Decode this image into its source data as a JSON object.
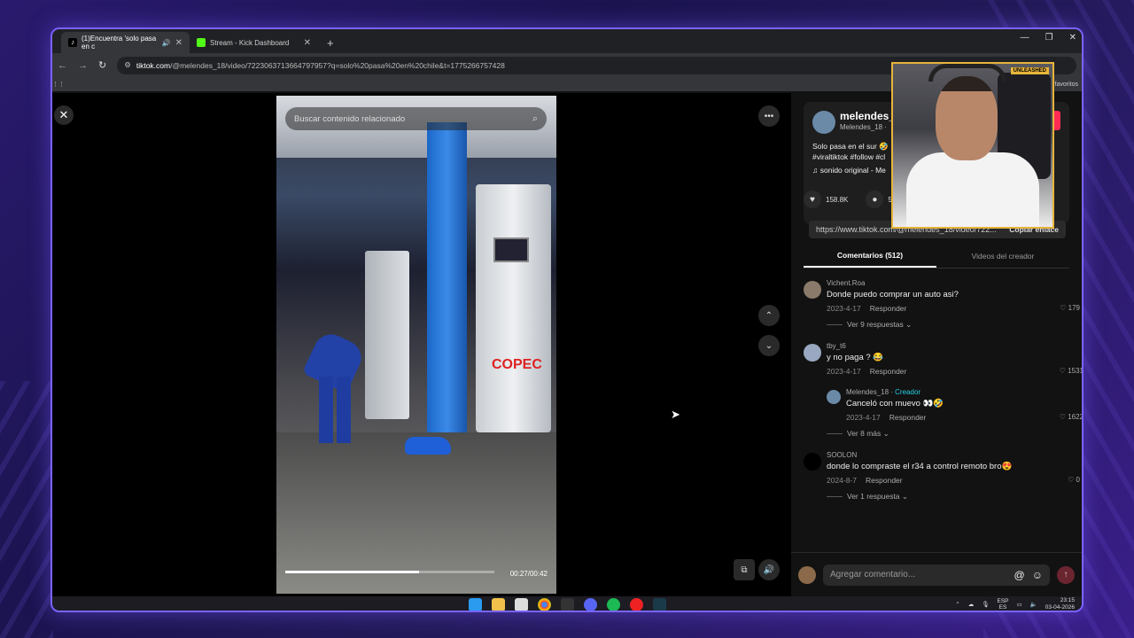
{
  "browser": {
    "tabs": [
      {
        "label": "(1)Encuentra 'solo pasa en c",
        "active": true
      },
      {
        "label": "Stream - Kick Dashboard",
        "active": false
      }
    ],
    "url_host": "tiktok.com",
    "url_path": "/@melendes_18/video/7223063713664797957?q=solo%20pasa%20en%20chile&t=1775266757428",
    "bookmarks_label": "favoritos"
  },
  "video": {
    "search_placeholder": "Buscar contenido relacionado",
    "time": "00:27/00:42",
    "progress": 0.64,
    "pump_brand": "COPEC"
  },
  "author": {
    "name": "melendes_1",
    "handle": "Melendes_18 · ",
    "description_line1": "Solo pasa en el sur 🤣",
    "description_line2": "#viraltiktok #follow #cl",
    "music": "♫  sonido original - Me"
  },
  "stats": {
    "likes": "158.8K",
    "comments": "51"
  },
  "share": {
    "url": "https://www.tiktok.com/@melendes_18/video/722...",
    "copy_label": "Copiar enlace"
  },
  "comment_tabs": [
    {
      "label": "Comentarios (512)",
      "active": true
    },
    {
      "label": "Videos del creador",
      "active": false
    }
  ],
  "comments": [
    {
      "user": "Vichent.Roa",
      "creator": "",
      "text": "Donde puedo comprar un auto asi?",
      "date": "2023-4-17",
      "reply": "Responder",
      "likes": "179",
      "more": "Ver 9 respuestas ⌄"
    },
    {
      "user": "tby_t6",
      "creator": "",
      "text": "y no paga ? 😂",
      "date": "2023-4-17",
      "reply": "Responder",
      "likes": "1531",
      "more": ""
    },
    {
      "user": "Melendes_18 · ",
      "creator": "Creador",
      "text": "Canceló con muevo 👀🤣",
      "date": "2023-4-17",
      "reply": "Responder",
      "likes": "1622",
      "more": "Ver 8 más ⌄"
    },
    {
      "user": "SOOLON",
      "creator": "",
      "text": "donde lo compraste el r34 a control remoto bro😍",
      "date": "2024-8-7",
      "reply": "Responder",
      "likes": "0",
      "more": "Ver 1 respuesta ⌄"
    }
  ],
  "compose": {
    "placeholder": "Agregar comentario..."
  },
  "taskbar": {
    "lang1": "ESP",
    "lang2": "ES",
    "time": "23:15",
    "date": "03-04-2026"
  },
  "webcam": {
    "tag": "UNLEASHED"
  },
  "colors": {
    "accent": "#fe2c55",
    "window_border": "#7a63ff",
    "creator": "#25d0e6",
    "webcam_border": "#e7b43a"
  }
}
